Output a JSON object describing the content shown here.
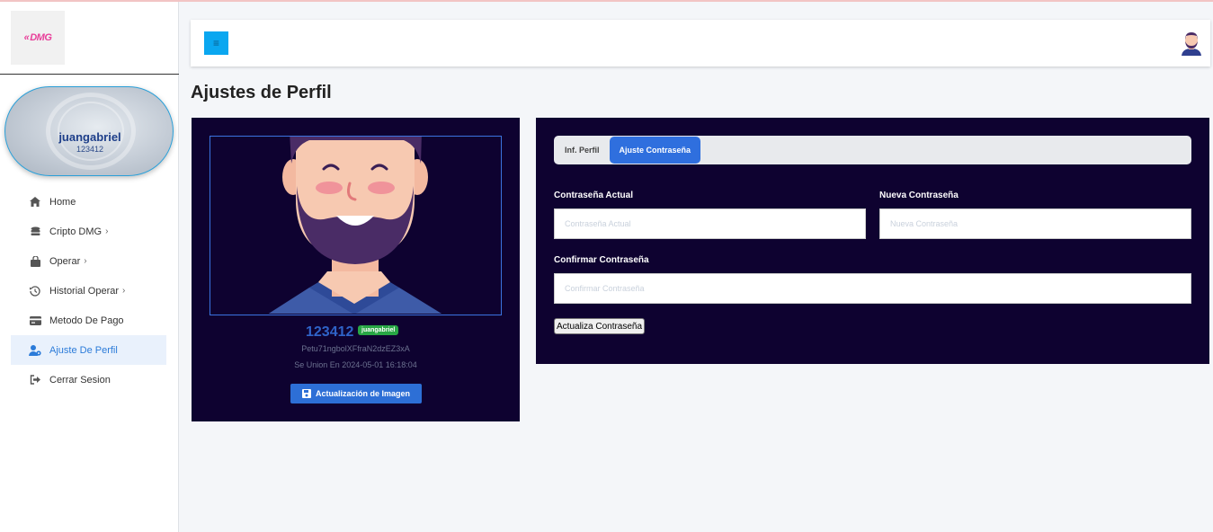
{
  "sidebar": {
    "logo": {
      "text": "DMG",
      "icon": "dmg-logo"
    },
    "user": {
      "name": "juangabriel",
      "id": "123412"
    },
    "items": [
      {
        "label": "Home",
        "icon": "home-icon",
        "has_submenu": false,
        "active": false
      },
      {
        "label": "Cripto DMG",
        "icon": "coins-icon",
        "has_submenu": true,
        "active": false
      },
      {
        "label": "Operar",
        "icon": "shopping-bag-icon",
        "has_submenu": true,
        "active": false
      },
      {
        "label": "Historial Operar",
        "icon": "history-icon",
        "has_submenu": true,
        "active": false
      },
      {
        "label": "Metodo De Pago",
        "icon": "credit-card-icon",
        "has_submenu": false,
        "active": false
      },
      {
        "label": "Ajuste De Perfil",
        "icon": "user-cog-icon",
        "has_submenu": false,
        "active": true
      },
      {
        "label": "Cerrar Sesion",
        "icon": "sign-out-icon",
        "has_submenu": false,
        "active": false
      }
    ]
  },
  "header": {
    "menu_icon": "hamburger-icon",
    "avatar_icon": "user-avatar-icon"
  },
  "page": {
    "title": "Ajustes de Perfil"
  },
  "profile_card": {
    "user_id": "123412",
    "username_badge": "juangabriel",
    "token": "Petu71ngbolXFfraN2dzEZ3xA",
    "joined": "Se Union En 2024-05-01 16:18:04",
    "update_image_label": "Actualización de Imagen"
  },
  "settings_card": {
    "tabs": [
      {
        "label": "Inf. Perfil",
        "active": false
      },
      {
        "label": "Ajuste Contraseña",
        "active": true
      }
    ],
    "fields": {
      "current_password": {
        "label": "Contraseña Actual",
        "placeholder": "Contraseña Actual",
        "value": ""
      },
      "new_password": {
        "label": "Nueva Contraseña",
        "placeholder": "Nueva Contraseña",
        "value": ""
      },
      "confirm_password": {
        "label": "Confirmar Contraseña",
        "placeholder": "Confirmar Contraseña",
        "value": ""
      }
    },
    "submit_label": "Actualiza Contraseña"
  },
  "colors": {
    "accent": "#2f6fde",
    "card_bg": "#0e0230",
    "menu_button": "#0aa7f0",
    "badge_green": "#28a745",
    "logo_pink": "#e8409a"
  }
}
